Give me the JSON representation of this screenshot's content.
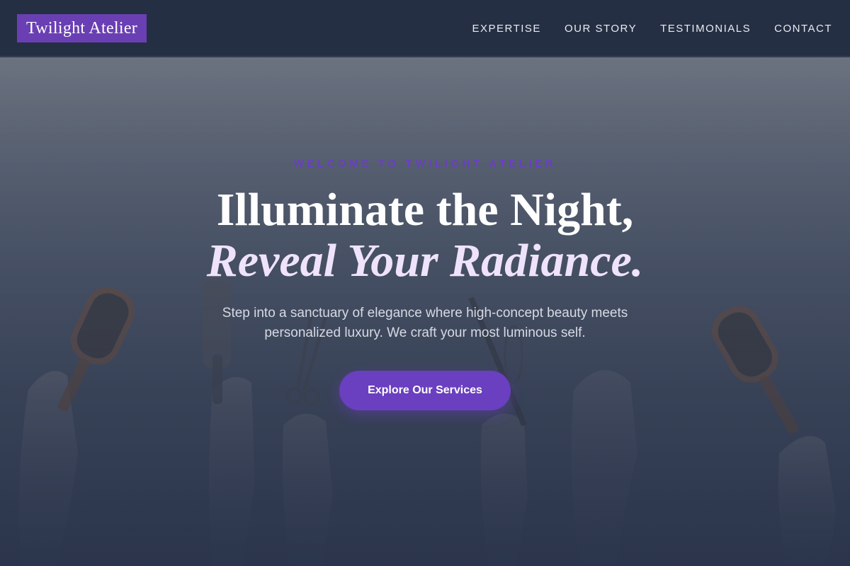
{
  "brand": {
    "logo_text": "Twilight Atelier"
  },
  "nav": {
    "items": [
      {
        "label": "EXPERTISE"
      },
      {
        "label": "OUR STORY"
      },
      {
        "label": "TESTIMONIALS"
      },
      {
        "label": "CONTACT"
      }
    ]
  },
  "hero": {
    "eyebrow": "WELCOME TO TWILIGHT ATELIER",
    "headline_line1": "Illuminate the Night,",
    "headline_line2": "Reveal Your Radiance.",
    "subtext": "Step into a sanctuary of elegance where high-concept beauty meets personalized luxury. We craft your most luminous self.",
    "cta_label": "Explore Our Services"
  },
  "colors": {
    "header_bg": "#252f43",
    "accent": "#6a3fc0",
    "headline_white": "#ffffff",
    "headline_lavender": "#efe3fb"
  }
}
